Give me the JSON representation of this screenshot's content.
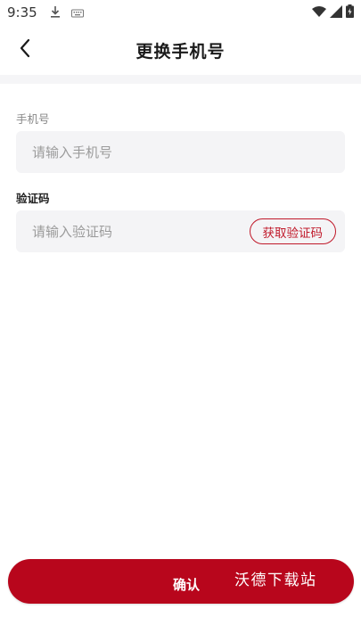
{
  "status_bar": {
    "time": "9:35",
    "icons": [
      "download-icon",
      "keyboard-icon",
      "wifi-icon",
      "signal-icon",
      "battery-icon"
    ]
  },
  "header": {
    "title": "更换手机号",
    "back_icon": "chevron-left-icon"
  },
  "form": {
    "phone_label": "手机号",
    "phone_placeholder": "请输入手机号",
    "phone_value": "",
    "code_label": "验证码",
    "code_placeholder": "请输入验证码",
    "code_value": "",
    "get_code_label": "获取验证码"
  },
  "footer": {
    "confirm_label": "确认"
  },
  "watermark": {
    "text": "沃德下载站"
  },
  "colors": {
    "accent": "#b8061c",
    "accent_outline": "#c0192a",
    "field_bg": "#f4f4f6",
    "placeholder": "#9b9b9b"
  }
}
